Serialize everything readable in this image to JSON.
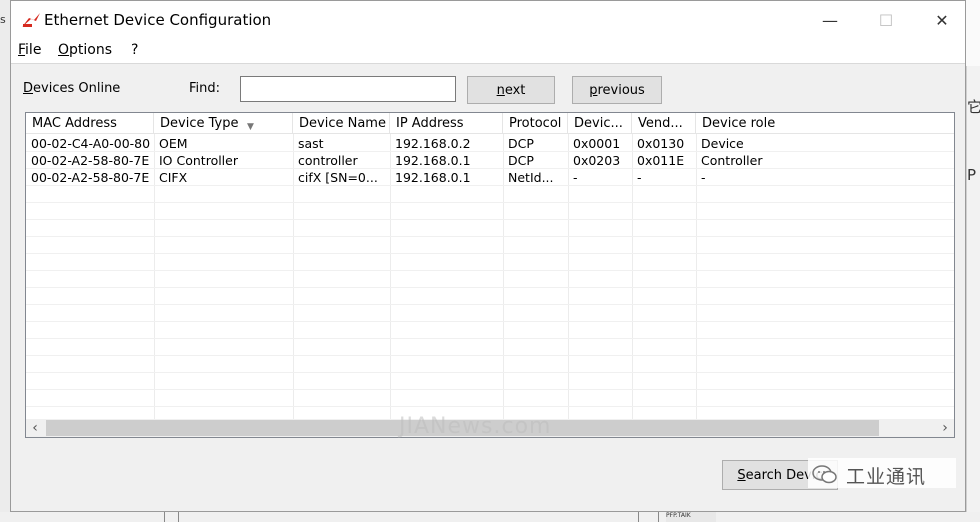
{
  "window": {
    "title": "Ethernet Device Configuration",
    "controls": {
      "minimize": "—",
      "maximize": "☐",
      "close": "✕"
    }
  },
  "menu": {
    "items": [
      "File",
      "Options",
      "?"
    ]
  },
  "toolbar": {
    "devices_online_label": "Devices Online",
    "find_label": "Find:",
    "find_value": "",
    "next_label": "next",
    "previous_label": "previous"
  },
  "table": {
    "columns": [
      "MAC Address",
      "Device Type",
      "Device Name",
      "IP Address",
      "Protocol",
      "Devic...",
      "Vend...",
      "Device role"
    ],
    "rows": [
      [
        "00-02-C4-A0-00-80",
        "OEM",
        "sast",
        "192.168.0.2",
        "DCP",
        "0x0001",
        "0x0130",
        "Device"
      ],
      [
        "00-02-A2-58-80-7E",
        "IO Controller",
        "controller",
        "192.168.0.1",
        "DCP",
        "0x0203",
        "0x011E",
        "Controller"
      ],
      [
        "00-02-A2-58-80-7E",
        "CIFX",
        "cifX [SN=0...",
        "192.168.0.1",
        "NetId...",
        "-",
        "-",
        "-"
      ]
    ]
  },
  "scrollbar": {
    "left_arrow": "‹",
    "right_arrow": "›"
  },
  "footer": {
    "search_button_label": "Search Devic"
  },
  "overlays": {
    "watermark_text": "JIANews.com",
    "badge_text": "工业通讯"
  },
  "background": {
    "left_char": "s",
    "right_char_1": "它",
    "right_char_2": "P",
    "bottom_text": "PFP.TAIK"
  },
  "colors": {
    "brand_icon": "#d62a1f"
  }
}
